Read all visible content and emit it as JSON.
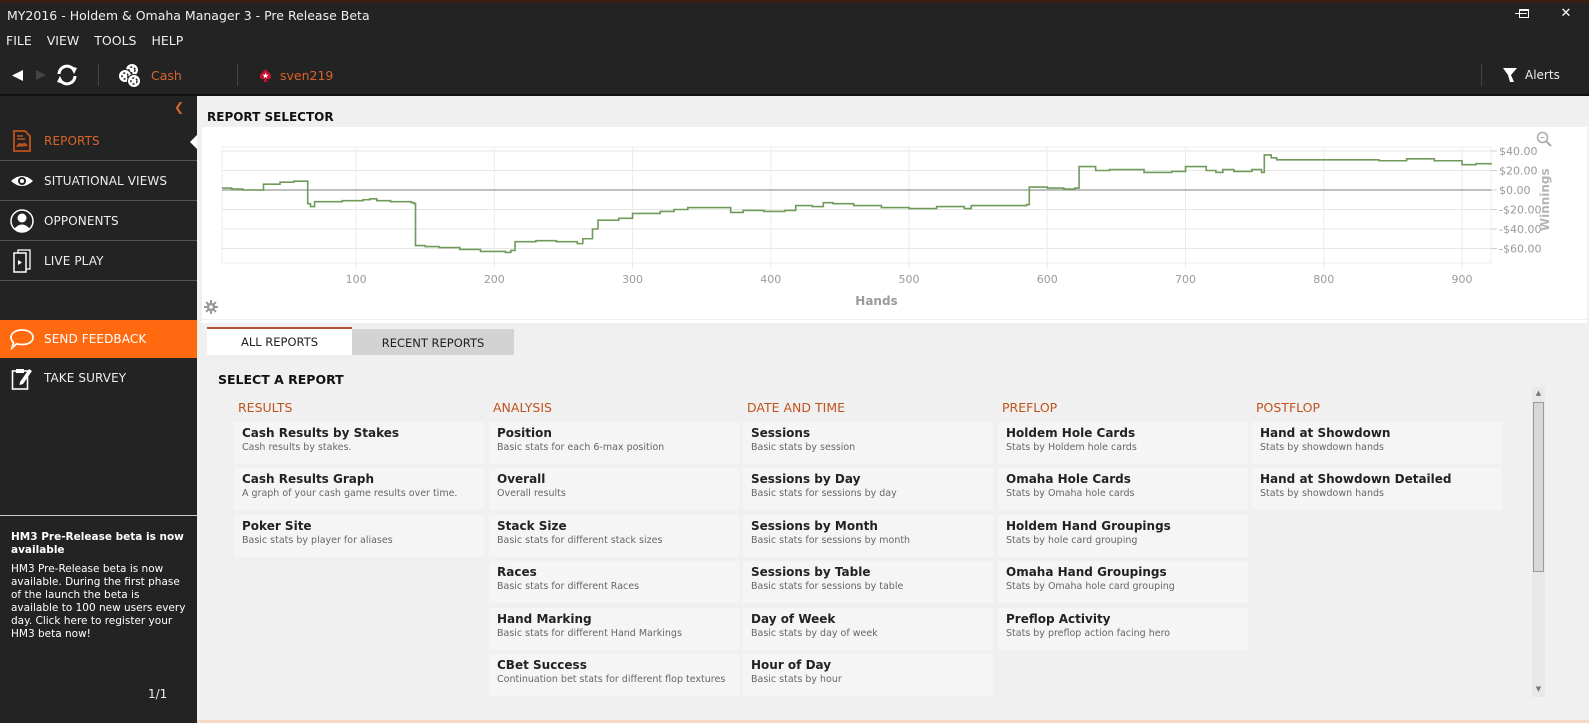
{
  "window": {
    "title": "MY2016 - Holdem & Omaha Manager 3 - Pre Release Beta",
    "controls": {
      "minimize": "minimize-icon",
      "maximize": "maximize-icon",
      "close": "close-icon"
    }
  },
  "menu": [
    "FILE",
    "VIEW",
    "TOOLS",
    "HELP"
  ],
  "toolbar": {
    "game_type": "Cash",
    "player": "sven219",
    "alerts": "Alerts",
    "icons": [
      "back-arrow-icon",
      "forward-arrow-icon",
      "refresh-icon",
      "poker-chips-icon",
      "pokerstars-logo-icon",
      "filter-icon"
    ]
  },
  "sidebar": {
    "items": [
      {
        "label": "REPORTS",
        "icon": "reports-icon",
        "active": true
      },
      {
        "label": "SITUATIONAL VIEWS",
        "icon": "eye-icon"
      },
      {
        "label": "OPPONENTS",
        "icon": "user-icon"
      },
      {
        "label": "LIVE PLAY",
        "icon": "live-play-icon"
      }
    ],
    "feedback": {
      "label": "SEND FEEDBACK",
      "icon": "speech-bubble-icon"
    },
    "survey": {
      "label": "TAKE SURVEY",
      "icon": "survey-icon"
    },
    "news": {
      "title": "HM3 Pre-Release beta is now available",
      "body": "HM3 Pre-Release beta is now available. During the first phase of the launch the beta is available to 100 new users every day.  Click here to register your HM3 beta now!",
      "pager": "1/1"
    }
  },
  "report_selector": {
    "title": "REPORT SELECTOR"
  },
  "chart_data": {
    "type": "line",
    "title": "",
    "xlabel": "Hands",
    "ylabel": "Winnings",
    "xlim": [
      3,
      921
    ],
    "ylim": [
      -70,
      50
    ],
    "x_ticks": [
      100,
      200,
      300,
      400,
      500,
      600,
      700,
      800,
      900
    ],
    "y_ticks": [
      40,
      20,
      0,
      -20,
      -40,
      -60
    ],
    "y_tick_labels": [
      "$40.00",
      "$20.00",
      "$0.00",
      "-$20.00",
      "-$40.00",
      "-$60.00"
    ],
    "grid": true,
    "series": [
      {
        "name": "Winnings",
        "color": "#6f9a5a",
        "x": [
          3,
          10,
          18,
          25,
          32,
          33,
          45,
          55,
          64,
          65,
          67,
          70,
          90,
          105,
          110,
          115,
          125,
          140,
          142,
          143,
          150,
          160,
          175,
          190,
          200,
          208,
          212,
          215,
          230,
          245,
          260,
          264,
          268,
          271,
          275,
          290,
          300,
          320,
          330,
          340,
          360,
          368,
          371,
          380,
          395,
          410,
          418,
          430,
          438,
          445,
          460,
          480,
          500,
          520,
          540,
          545,
          570,
          585,
          587,
          600,
          612,
          620,
          623,
          635,
          645,
          660,
          670,
          690,
          700,
          715,
          722,
          727,
          735,
          748,
          755,
          757,
          762,
          766,
          780,
          800,
          820,
          840,
          860,
          880,
          900,
          910,
          921
        ],
        "y": [
          2,
          1,
          0,
          0,
          0,
          6,
          8,
          9,
          9,
          -14,
          -17,
          -12,
          -11,
          -10,
          -9,
          -11,
          -12,
          -13,
          -14,
          -57,
          -58,
          -59,
          -61,
          -63,
          -63,
          -64,
          -62,
          -53,
          -52,
          -53,
          -55,
          -50,
          -50,
          -40,
          -31,
          -29,
          -24,
          -22,
          -20,
          -18,
          -18,
          -18,
          -23,
          -21,
          -22,
          -21,
          -16,
          -17,
          -13,
          -14,
          -16,
          -18,
          -19,
          -17,
          -19,
          -16,
          -16,
          -15,
          3,
          2,
          1,
          2,
          24,
          20,
          21,
          21,
          18,
          19,
          24,
          20,
          18,
          21,
          19,
          21,
          18,
          36,
          33,
          31,
          31,
          31,
          31,
          30,
          32,
          30,
          26,
          27,
          26
        ]
      }
    ],
    "zero_line": true
  },
  "tabs": [
    {
      "label": "ALL REPORTS",
      "active": true
    },
    {
      "label": "RECENT REPORTS",
      "active": false
    }
  ],
  "select_title": "SELECT A REPORT",
  "categories": [
    {
      "name": "RESULTS",
      "reports": [
        {
          "title": "Cash Results by Stakes",
          "desc": "Cash results by stakes."
        },
        {
          "title": "Cash Results Graph",
          "desc": "A graph of your cash game results over time."
        },
        {
          "title": "Poker Site",
          "desc": "Basic stats by player for aliases"
        }
      ]
    },
    {
      "name": "ANALYSIS",
      "reports": [
        {
          "title": "Position",
          "desc": "Basic stats for each 6-max position"
        },
        {
          "title": "Overall",
          "desc": "Overall results"
        },
        {
          "title": "Stack Size",
          "desc": "Basic stats for different stack sizes"
        },
        {
          "title": "Races",
          "desc": "Basic stats for different Races"
        },
        {
          "title": "Hand Marking",
          "desc": "Basic stats for different Hand Markings"
        },
        {
          "title": "CBet Success",
          "desc": "Continuation bet stats for different flop textures"
        }
      ]
    },
    {
      "name": "DATE AND TIME",
      "reports": [
        {
          "title": "Sessions",
          "desc": "Basic stats by session"
        },
        {
          "title": "Sessions by Day",
          "desc": "Basic stats for sessions by day"
        },
        {
          "title": "Sessions by Month",
          "desc": "Basic stats for sessions by month"
        },
        {
          "title": "Sessions by Table",
          "desc": "Basic stats for sessions by table"
        },
        {
          "title": "Day of Week",
          "desc": "Basic stats by day of week"
        },
        {
          "title": "Hour of Day",
          "desc": "Basic stats by hour"
        }
      ]
    },
    {
      "name": "PREFLOP",
      "reports": [
        {
          "title": "Holdem Hole Cards",
          "desc": "Stats by Holdem hole cards"
        },
        {
          "title": "Omaha Hole Cards",
          "desc": "Stats by Omaha hole cards"
        },
        {
          "title": "Holdem Hand Groupings",
          "desc": "Stats by hole card grouping"
        },
        {
          "title": "Omaha Hand Groupings",
          "desc": "Stats by Omaha hole card grouping"
        },
        {
          "title": "Preflop Activity",
          "desc": "Stats by preflop action facing hero"
        }
      ]
    },
    {
      "name": "POSTFLOP",
      "reports": [
        {
          "title": "Hand at Showdown",
          "desc": "Stats by showdown hands"
        },
        {
          "title": "Hand at Showdown Detailed",
          "desc": "Stats by showdown hands"
        }
      ]
    }
  ],
  "colors": {
    "accent": "#ff6a10",
    "accent_text": "#d9642a",
    "category_header": "#c0531c",
    "chart_line": "#6f9a5a"
  }
}
